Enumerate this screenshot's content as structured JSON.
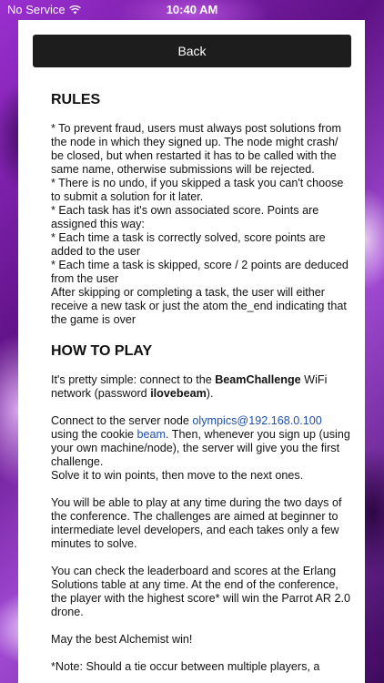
{
  "status_bar": {
    "carrier": "No Service",
    "time": "10:40 AM"
  },
  "header": {
    "back_label": "Back"
  },
  "rules": {
    "title": "RULES",
    "items": [
      "* To prevent fraud, users must always post solutions from the node in which they signed up. The node might crash/ be closed, but when restarted it has to be called with the same name, otherwise submissions will be rejected.",
      "* There is no undo, if you skipped a task you can't choose to submit a solution for it later.",
      "* Each task has it's own associated score. Points are assigned this way:",
      "* Each time a task is correctly solved, score points are added to the user",
      "* Each time a task is skipped, score / 2 points are deduced from the user",
      "After skipping or completing a task, the user will either receive a new task or just the atom the_end indicating that the game is over"
    ]
  },
  "how_to_play": {
    "title": "HOW TO PLAY",
    "p1_before": "It's pretty simple: connect to the ",
    "p1_network": "BeamChallenge",
    "p1_middle": " WiFi network (password ",
    "p1_password": "ilovebeam",
    "p1_after": ").",
    "p2_before": "Connect to the server node ",
    "p2_node": "olympics@192.168.0.100",
    "p2_middle": " using the cookie ",
    "p2_cookie": "beam",
    "p2_after": ". Then, whenever you sign up (using your own machine/node), the server will give you the first challenge.",
    "p2_line2": "Solve it to win points, then move to the next ones.",
    "p3": "You will be able to play at any time during the two days of the conference. The challenges are aimed at beginner to intermediate level developers, and each takes only a few minutes to solve.",
    "p4": "You can check the leaderboard and scores at the Erlang Solutions table at any time. At the end of the conference, the player with the highest score* will win the Parrot AR 2.0 drone.",
    "p5": "May the best Alchemist win!",
    "note": "*Note: Should a tie occur between multiple players, a"
  }
}
